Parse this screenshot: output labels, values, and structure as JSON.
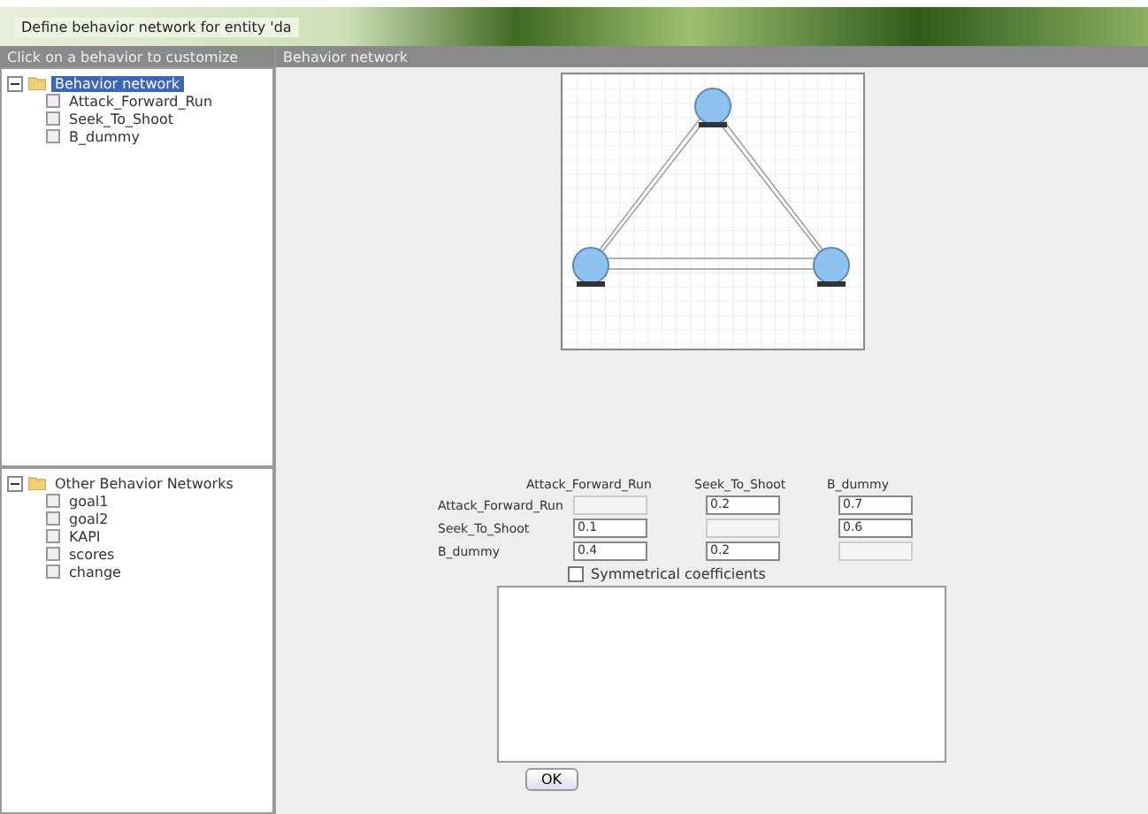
{
  "window": {
    "title": "Define behavior network for entity 'da"
  },
  "left_header": "Click on a behavior to customize",
  "right_header": "Behavior network",
  "behavior_tree": {
    "label": "Behavior network",
    "selected": true,
    "expanded": true,
    "children": [
      {
        "label": "Attack_Forward_Run",
        "selected": false
      },
      {
        "label": "Seek_To_Shoot",
        "selected": false
      },
      {
        "label": "B_dummy",
        "selected": false
      }
    ]
  },
  "other_tree": {
    "label": "Other Behavior Networks",
    "selected": false,
    "expanded": true,
    "children": [
      {
        "label": "goal1",
        "selected": false
      },
      {
        "label": "goal2",
        "selected": false
      },
      {
        "label": "KAPI",
        "selected": false
      },
      {
        "label": "scores",
        "selected": false
      },
      {
        "label": "change",
        "selected": false
      }
    ]
  },
  "matrix": {
    "columns": [
      "Attack_Forward_Run",
      "Seek_To_Shoot",
      "B_dummy"
    ],
    "rows": [
      {
        "label": "Attack_Forward_Run",
        "cells": [
          {
            "disabled": true
          },
          {
            "value": "0.2",
            "disabled": false
          },
          {
            "value": "0.7",
            "disabled": false
          }
        ]
      },
      {
        "label": "Seek_To_Shoot",
        "cells": [
          {
            "value": "0.1",
            "disabled": false
          },
          {
            "disabled": true
          },
          {
            "value": "0.6",
            "disabled": false
          }
        ]
      },
      {
        "label": "B_dummy",
        "cells": [
          {
            "value": "0.4",
            "disabled": false
          },
          {
            "value": "0.2",
            "disabled": false
          },
          {
            "disabled": true
          }
        ]
      }
    ]
  },
  "symmetric": {
    "label": "Symmetrical coefficients",
    "checked": false
  },
  "ok_button": "OK"
}
